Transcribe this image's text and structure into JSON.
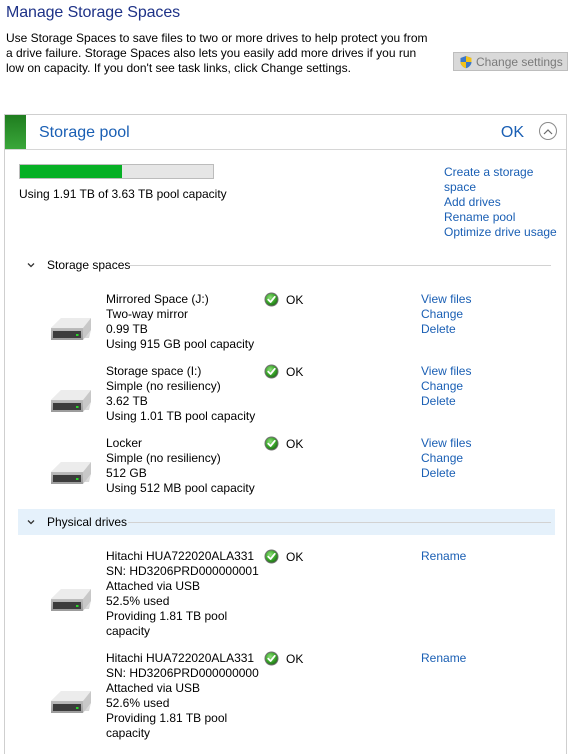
{
  "header": {
    "title": "Manage Storage Spaces",
    "description": "Use Storage Spaces to save files to two or more drives to help protect you from a drive failure. Storage Spaces also lets you easily add more drives if you run low on capacity. If you don't see task links, click Change settings.",
    "change_settings_label": "Change settings",
    "change_settings_icon": "uac-shield-icon"
  },
  "pool": {
    "title": "Storage pool",
    "status": "OK",
    "accent_color": "#2e9a2e",
    "usage_fraction": 0.526,
    "usage_text": "Using 1.91 TB of 3.63 TB pool capacity",
    "links": [
      "Create a storage space",
      "Add drives",
      "Rename pool",
      "Optimize drive usage"
    ]
  },
  "storage_spaces": {
    "label": "Storage spaces",
    "items": [
      {
        "lines": [
          "Mirrored Space (J:)",
          "Two-way mirror",
          "0.99 TB",
          "Using 915 GB pool capacity"
        ],
        "status": "OK",
        "actions": [
          "View files",
          "Change",
          "Delete"
        ]
      },
      {
        "lines": [
          "Storage space (I:)",
          "Simple (no resiliency)",
          "3.62 TB",
          "Using 1.01 TB pool capacity"
        ],
        "status": "OK",
        "actions": [
          "View files",
          "Change",
          "Delete"
        ]
      },
      {
        "lines": [
          "Locker",
          "Simple (no resiliency)",
          "512 GB",
          "Using 512 MB pool capacity"
        ],
        "status": "OK",
        "actions": [
          "View files",
          "Change",
          "Delete"
        ]
      }
    ]
  },
  "physical_drives": {
    "label": "Physical drives",
    "items": [
      {
        "lines": [
          "Hitachi HUA722020ALA331",
          "SN: HD3206PRD000000001",
          "Attached via USB",
          "52.5% used",
          "Providing 1.81 TB pool",
          "capacity"
        ],
        "status": "OK",
        "actions": [
          "Rename"
        ]
      },
      {
        "lines": [
          "Hitachi HUA722020ALA331",
          "SN: HD3206PRD000000000",
          "Attached via USB",
          "52.6% used",
          "Providing 1.81 TB pool",
          "capacity"
        ],
        "status": "OK",
        "actions": [
          "Rename"
        ]
      }
    ]
  }
}
